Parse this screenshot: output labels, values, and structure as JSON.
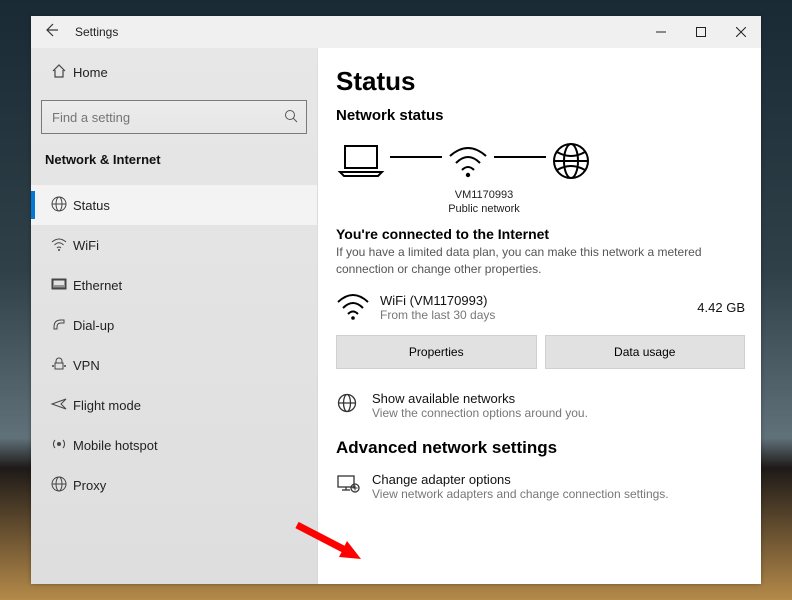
{
  "titlebar": {
    "title": "Settings"
  },
  "sidebar": {
    "home": "Home",
    "search_placeholder": "Find a setting",
    "group": "Network & Internet",
    "items": [
      {
        "label": "Status"
      },
      {
        "label": "WiFi"
      },
      {
        "label": "Ethernet"
      },
      {
        "label": "Dial-up"
      },
      {
        "label": "VPN"
      },
      {
        "label": "Flight mode"
      },
      {
        "label": "Mobile hotspot"
      },
      {
        "label": "Proxy"
      }
    ]
  },
  "main": {
    "title": "Status",
    "subtitle": "Network status",
    "network_name": "VM1170993",
    "network_type": "Public network",
    "lead": "You're connected to the Internet",
    "desc": "If you have a limited data plan, you can make this network a metered connection or change other properties.",
    "conn": {
      "name": "WiFi (VM1170993)",
      "sub": "From the last 30 days",
      "usage": "4.42 GB"
    },
    "btn_properties": "Properties",
    "btn_usage": "Data usage",
    "show_networks": {
      "title": "Show available networks",
      "sub": "View the connection options around you."
    },
    "adv_title": "Advanced network settings",
    "adapter": {
      "title": "Change adapter options",
      "sub": "View network adapters and change connection settings."
    }
  }
}
